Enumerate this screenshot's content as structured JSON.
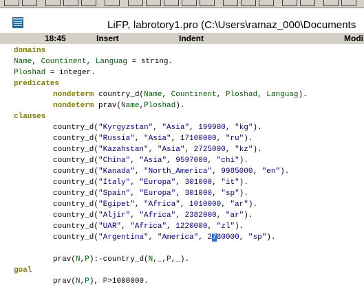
{
  "window": {
    "title": "LiFP, labrotory1.pro (C:\\Users\\ramaz_000\\Documents",
    "icon": "app-icon"
  },
  "status": {
    "time": "18:45",
    "mode": "Insert",
    "indent": "Indent",
    "modified": "Modi"
  },
  "code": {
    "l0": [
      "domains"
    ],
    "l1": [
      "Name",
      ", ",
      "Countinent",
      ", ",
      "Languag",
      " = string."
    ],
    "l2": [
      "Ploshad",
      " = integer."
    ],
    "l3": [
      "predicates"
    ],
    "l4": [
      "nondeterm",
      " country_d(",
      "Name",
      ", ",
      "Countinent",
      ", ",
      "Ploshad",
      ", ",
      "Languag",
      ")."
    ],
    "l5": [
      "nondeterm",
      " prav(",
      "Name",
      ",",
      "Ploshad",
      ")."
    ],
    "l6": [
      "clauses"
    ],
    "facts": [
      {
        "name": "\"Kyrgyzstan\"",
        "cont": "\"Asia\"",
        "area": "199900",
        "lang": "\"kg\""
      },
      {
        "name": "\"Russia\"",
        "cont": "\"Asia\"",
        "area": "17100000",
        "lang": "\"ru\""
      },
      {
        "name": "\"Kazahstan\"",
        "cont": "\"Asia\"",
        "area": "2725000",
        "lang": "\"kz\""
      },
      {
        "name": "\"China\"",
        "cont": "\"Asia\"",
        "area": "9597000",
        "lang": "\"chi\""
      },
      {
        "name": "\"Kanada\"",
        "cont": "\"North_America\"",
        "area": "9985000",
        "lang": "\"en\""
      },
      {
        "name": "\"Italy\"",
        "cont": "\"Europa\"",
        "area": "301000",
        "lang": "\"it\""
      },
      {
        "name": "\"Spain\"",
        "cont": "\"Europa\"",
        "area": "301000",
        "lang": "\"sp\""
      },
      {
        "name": "\"Egipet\"",
        "cont": "\"Africa\"",
        "area": "1010000",
        "lang": "\"ar\""
      },
      {
        "name": "\"Aljir\"",
        "cont": "\"Africa\"",
        "area": "2382000",
        "lang": "\"ar\""
      },
      {
        "name": "\"UAR\"",
        "cont": "\"Africa\"",
        "area": "1220000",
        "lang": "\"zl\""
      }
    ],
    "last_fact": {
      "pre": "country_d(\"Argentina\", \"America\", ",
      "area_a": "2",
      "area_sel": "7",
      "area_b": "80000",
      "post": ", \"sp\")."
    },
    "rule": [
      "prav(",
      "N",
      ",",
      "P",
      "):-country_d(",
      "N",
      ",_,",
      "P",
      ",_)."
    ],
    "goal_kw": "goal",
    "goal": [
      "prav(",
      "N",
      ",",
      "P",
      "), ",
      "P",
      ">1000000."
    ]
  }
}
